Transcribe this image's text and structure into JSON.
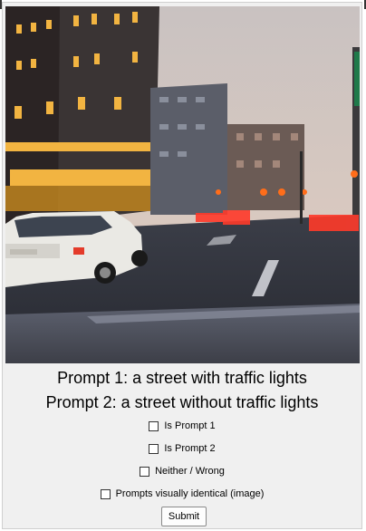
{
  "prompts": {
    "prompt1": "Prompt 1: a street with traffic lights",
    "prompt2": "Prompt 2: a street without traffic lights"
  },
  "options": [
    {
      "label": "Is Prompt 1",
      "checked": false
    },
    {
      "label": "Is Prompt 2",
      "checked": false
    },
    {
      "label": "Neither / Wrong",
      "checked": false
    },
    {
      "label": "Prompts visually identical (image)",
      "checked": false
    }
  ],
  "submit_label": "Submit",
  "colors": {
    "panel": "#f0f0f0",
    "sky": "#cfc6c2",
    "street_light": "#ff7a1a"
  }
}
